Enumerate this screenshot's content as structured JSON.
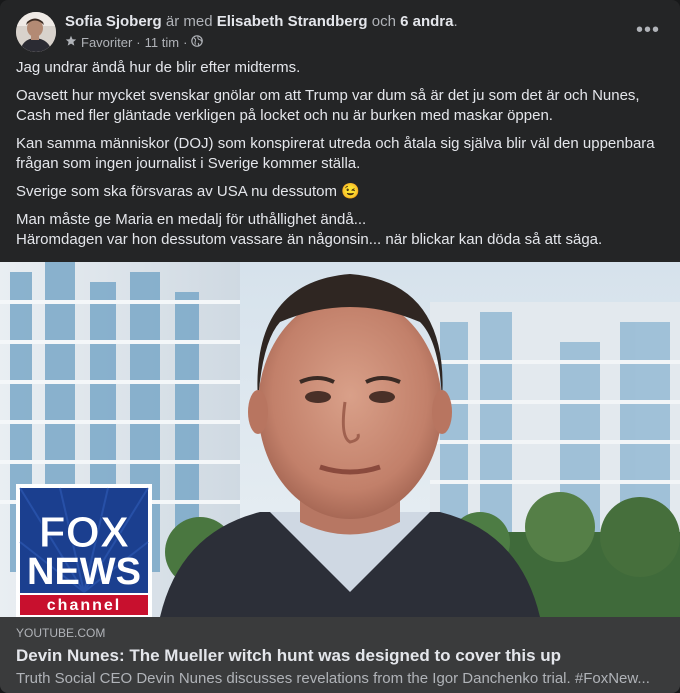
{
  "post": {
    "author": "Sofia Sjoberg",
    "with_text": "är med",
    "tagged": "Elisabeth Strandberg",
    "and_text": "och",
    "others": "6 andra",
    "period": ".",
    "favorites_label": "Favoriter",
    "separator": "·",
    "time": "11 tim",
    "separator2": "·",
    "more_label": "•••",
    "paragraphs": [
      "Jag undrar ändå hur de blir efter midterms.",
      "Oavsett hur mycket svenskar gnölar om att Trump var dum så är det ju som det är och Nunes, Cash med fler gläntade verkligen på  locket och nu är burken med maskar öppen.",
      "Kan samma människor (DOJ)  som konspirerat utreda och åtala sig själva blir väl den uppenbara frågan som ingen journalist i Sverige kommer ställa.",
      "Sverige som ska försvaras av USA nu dessutom 😉",
      "Man måste ge Maria en medalj för uthållighet ändå...",
      "Häromdagen var hon dessutom vassare än någonsin... när blickar kan döda så att säga."
    ]
  },
  "link_preview": {
    "logo_line1": "FOX",
    "logo_line2": "NEWS",
    "logo_line3": "channel",
    "domain": "YOUTUBE.COM",
    "title": "Devin Nunes: The Mueller witch hunt was designed to cover this up",
    "description": "Truth Social CEO Devin Nunes discusses revelations from the Igor Danchenko trial. #FoxNew..."
  },
  "colors": {
    "card_bg": "#242526",
    "footer_bg": "#3a3b3c",
    "text_primary": "#e4e6eb",
    "text_secondary": "#b0b3b8",
    "fox_blue": "#1b3f8f",
    "fox_red": "#c8102e"
  },
  "icons": {
    "favorite": "star-icon",
    "audience": "globe-icon",
    "more": "more-horizontal-icon"
  }
}
